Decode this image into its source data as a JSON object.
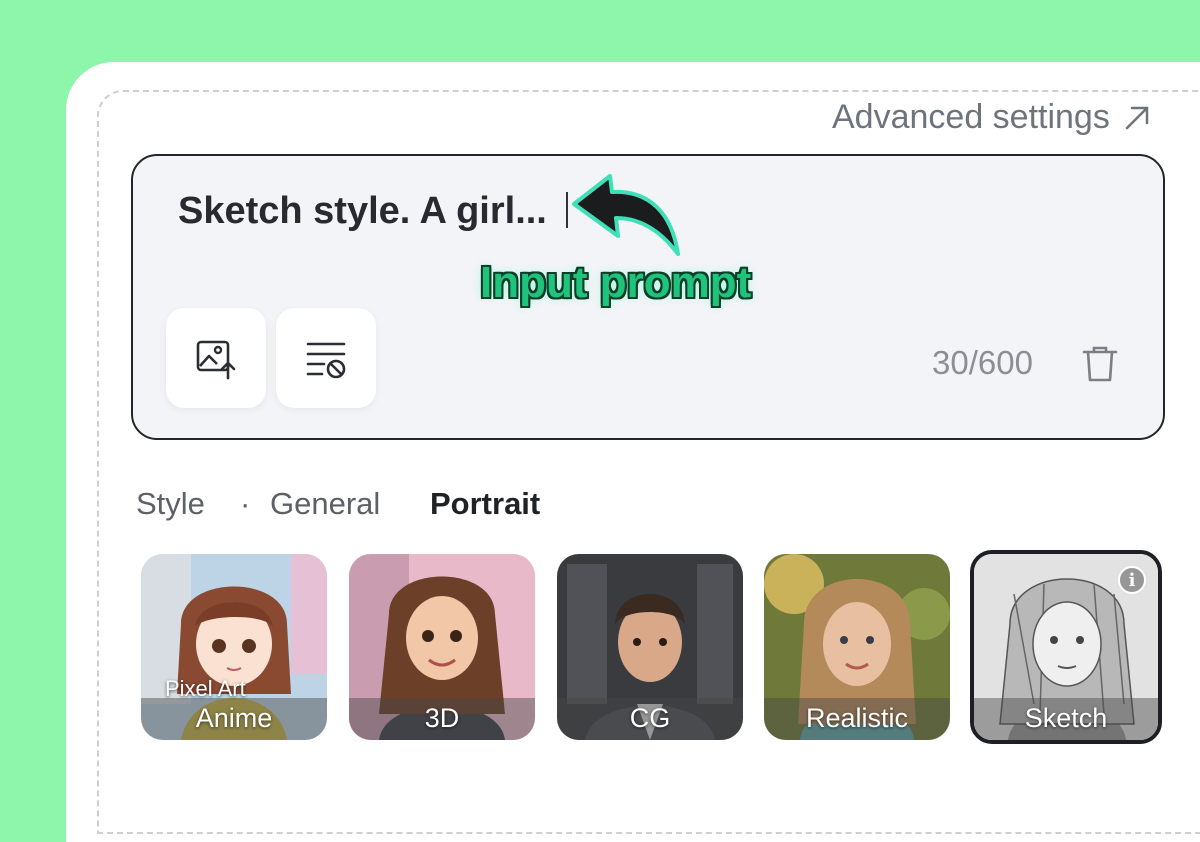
{
  "header": {
    "advanced_label": "Advanced settings",
    "advanced_icon": "arrow-up-right-icon"
  },
  "prompt": {
    "text": "Sketch style. A girl...",
    "counter": "30/600",
    "tools": [
      {
        "icon": "image-upload-icon"
      },
      {
        "icon": "negative-prompt-icon"
      }
    ],
    "delete_icon": "trash-icon"
  },
  "annotation": {
    "label": "Input prompt",
    "color": "#1ec47b"
  },
  "style_tabs": {
    "label": "Style",
    "separator": "·",
    "general": "General",
    "portrait": "Portrait",
    "active": "Portrait"
  },
  "style_cards": [
    {
      "name": "Anime",
      "sublabel": "Pixel Art"
    },
    {
      "name": "3D"
    },
    {
      "name": "CG"
    },
    {
      "name": "Realistic"
    },
    {
      "name": "Sketch",
      "selected": true
    }
  ],
  "colors": {
    "background": "#8ef6aa",
    "panel": "#ffffff",
    "prompt_bg": "#f3f4f7"
  }
}
